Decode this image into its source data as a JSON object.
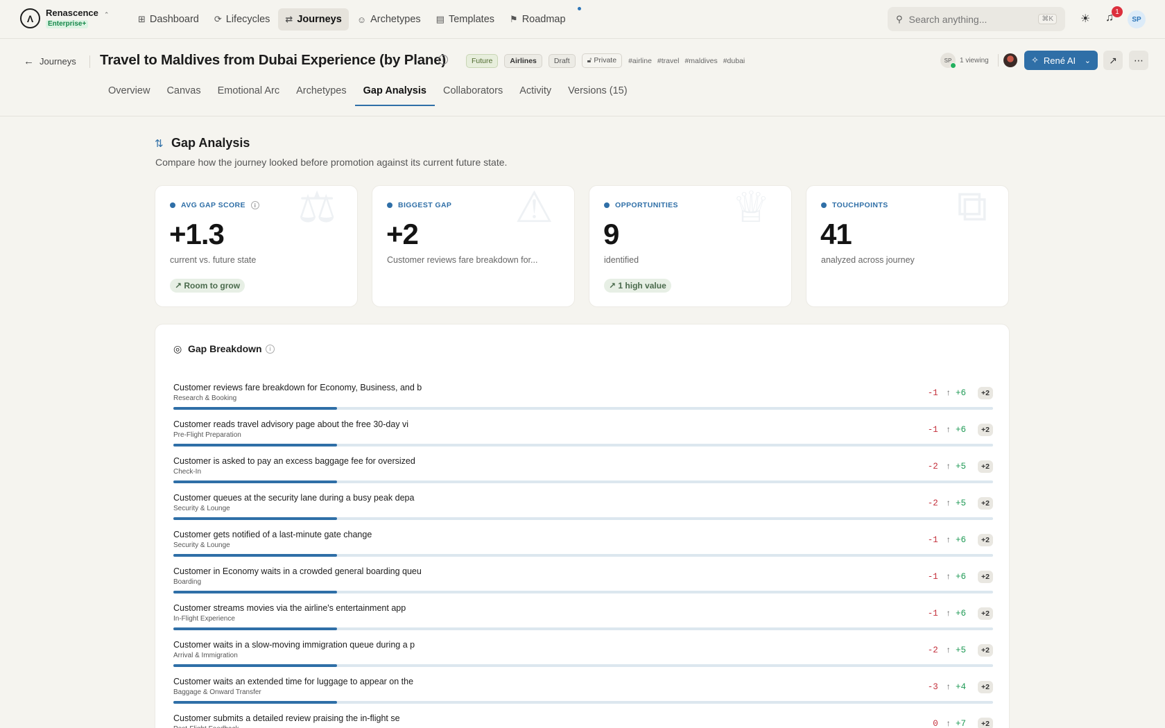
{
  "brand": {
    "name": "Renascence",
    "plan": "Enterprise+"
  },
  "nav": [
    {
      "label": "Dashboard",
      "icon": "grid-icon",
      "glyph": "⊞"
    },
    {
      "label": "Lifecycles",
      "icon": "cycle-icon",
      "glyph": "⟳"
    },
    {
      "label": "Journeys",
      "icon": "route-icon",
      "glyph": "⇄",
      "active": true
    },
    {
      "label": "Archetypes",
      "icon": "user-circle-icon",
      "glyph": "☺"
    },
    {
      "label": "Templates",
      "icon": "template-icon",
      "glyph": "▤"
    },
    {
      "label": "Roadmap",
      "icon": "signpost-icon",
      "glyph": "⚑",
      "dot": true
    }
  ],
  "search": {
    "placeholder": "Search anything...",
    "shortcut": "⌘K"
  },
  "notifications": {
    "count": "1"
  },
  "user": {
    "initials": "SP"
  },
  "header": {
    "back_label": "Journeys",
    "title": "Travel to Maldives from Dubai Experience (by Plane)",
    "state_chip": "Future",
    "industry_chip": "Airlines",
    "status_chip": "Draft",
    "visibility_chip": "Private",
    "tags": [
      "#airline",
      "#travel",
      "#maldives",
      "#dubai"
    ],
    "viewer_initials": "SP",
    "viewing_text": "1 viewing",
    "ai_button": "René AI"
  },
  "tabs": [
    "Overview",
    "Canvas",
    "Emotional Arc",
    "Archetypes",
    "Gap Analysis",
    "Collaborators",
    "Activity",
    "Versions (15)"
  ],
  "active_tab": "Gap Analysis",
  "section": {
    "title": "Gap Analysis",
    "subtitle": "Compare how the journey looked before promotion against its current future state."
  },
  "cards": [
    {
      "label": "AVG GAP SCORE",
      "value": "+1.3",
      "sub": "current vs. future state",
      "pill": "Room to grow",
      "info": true,
      "watermark": "⚖"
    },
    {
      "label": "BIGGEST GAP",
      "value": "+2",
      "sub": "Customer reviews fare breakdown for...",
      "pill": "",
      "watermark": "⚠"
    },
    {
      "label": "OPPORTUNITIES",
      "value": "9",
      "sub": "identified",
      "pill": "1 high value",
      "watermark": "♕"
    },
    {
      "label": "TOUCHPOINTS",
      "value": "41",
      "sub": "analyzed across journey",
      "pill": "",
      "watermark": "⧉"
    }
  ],
  "breakdown": {
    "title": "Gap Breakdown",
    "rows": [
      {
        "title": "Customer reviews fare breakdown for Economy, Business, and b",
        "stage": "Research & Booking",
        "current": "-1",
        "future": "+6",
        "gap": "+2",
        "progress": 0.2
      },
      {
        "title": "Customer reads travel advisory page about the free 30-day vi",
        "stage": "Pre-Flight Preparation",
        "current": "-1",
        "future": "+6",
        "gap": "+2",
        "progress": 0.2
      },
      {
        "title": "Customer is asked to pay an excess baggage fee for oversized",
        "stage": "Check-In",
        "current": "-2",
        "future": "+5",
        "gap": "+2",
        "progress": 0.2
      },
      {
        "title": "Customer queues at the security lane during a busy peak depa",
        "stage": "Security & Lounge",
        "current": "-2",
        "future": "+5",
        "gap": "+2",
        "progress": 0.2
      },
      {
        "title": "Customer gets notified of a last-minute gate change",
        "stage": "Security & Lounge",
        "current": "-1",
        "future": "+6",
        "gap": "+2",
        "progress": 0.2
      },
      {
        "title": "Customer in Economy waits in a crowded general boarding queu",
        "stage": "Boarding",
        "current": "-1",
        "future": "+6",
        "gap": "+2",
        "progress": 0.2
      },
      {
        "title": "Customer streams movies via the airline's entertainment app",
        "stage": "In-Flight Experience",
        "current": "-1",
        "future": "+6",
        "gap": "+2",
        "progress": 0.2
      },
      {
        "title": "Customer waits in a slow-moving immigration queue during a p",
        "stage": "Arrival & Immigration",
        "current": "-2",
        "future": "+5",
        "gap": "+2",
        "progress": 0.2
      },
      {
        "title": "Customer waits an extended time for luggage to appear on the",
        "stage": "Baggage & Onward Transfer",
        "current": "-3",
        "future": "+4",
        "gap": "+2",
        "progress": 0.2
      },
      {
        "title": "Customer submits a detailed review praising the in-flight se",
        "stage": "Post-Flight Feedback",
        "current": "0",
        "future": "+7",
        "gap": "+2",
        "progress": 0.2
      }
    ]
  }
}
